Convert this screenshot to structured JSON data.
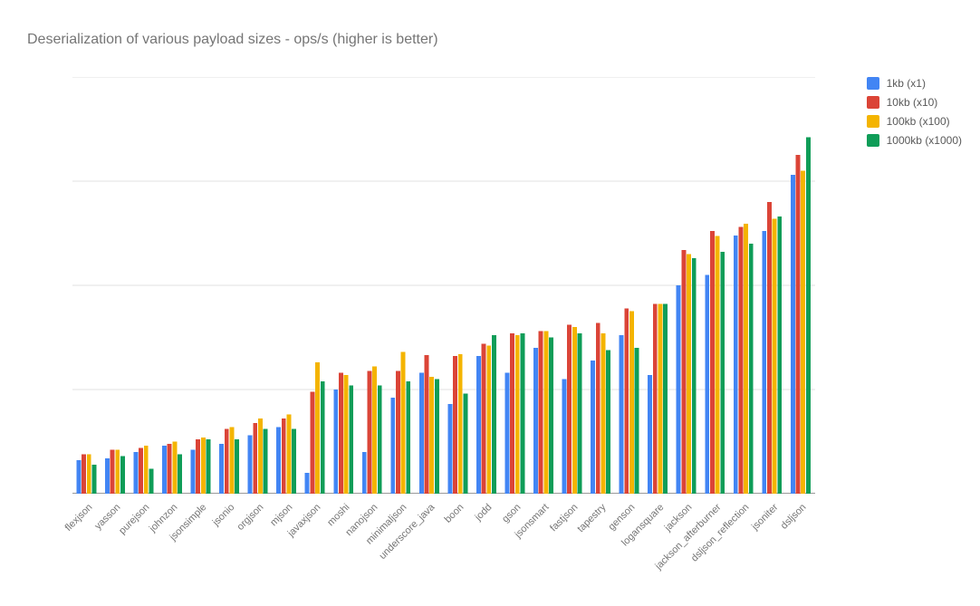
{
  "title": "Deserialization of various payload sizes  - ops/s (higher is better)",
  "legend": [
    {
      "label": "1kb (x1)",
      "color": "#4285f4"
    },
    {
      "label": "10kb (x10)",
      "color": "#db4437"
    },
    {
      "label": "100kb (x100)",
      "color": "#f4b400"
    },
    {
      "label": "1000kb (x1000)",
      "color": "#0f9d58"
    }
  ],
  "chart_data": {
    "type": "bar",
    "title": "Deserialization of various payload sizes  - ops/s (higher is better)",
    "xlabel": "",
    "ylabel": "",
    "ylim": [
      0,
      1000000
    ],
    "yticks": [
      0,
      250000,
      500000,
      750000,
      1000000
    ],
    "categories": [
      "flexjson",
      "yasson",
      "purejson",
      "johnzon",
      "jsonsimple",
      "jsonio",
      "orgjson",
      "mjson",
      "javaxjson",
      "moshi",
      "nanojson",
      "minimaljson",
      "underscore_java",
      "boon",
      "jodd",
      "gson",
      "jsonsmart",
      "fastjson",
      "tapestry",
      "genson",
      "logansquare",
      "jackson",
      "jackson_afterburner",
      "dsljson_reflection",
      "jsoniter",
      "dsljson"
    ],
    "series": [
      {
        "name": "1kb (x1)",
        "color": "#4285f4",
        "values": [
          80000,
          85000,
          100000,
          115000,
          105000,
          120000,
          140000,
          160000,
          50000,
          250000,
          100000,
          230000,
          290000,
          215000,
          330000,
          290000,
          350000,
          275000,
          320000,
          380000,
          285000,
          500000,
          525000,
          620000,
          630000,
          765000
        ]
      },
      {
        "name": "10kb (x10)",
        "color": "#db4437",
        "values": [
          95000,
          105000,
          110000,
          120000,
          130000,
          155000,
          170000,
          180000,
          245000,
          290000,
          295000,
          295000,
          333000,
          330000,
          360000,
          385000,
          390000,
          405000,
          410000,
          445000,
          455000,
          585000,
          630000,
          640000,
          700000,
          813000
        ]
      },
      {
        "name": "100kb (x100)",
        "color": "#f4b400",
        "values": [
          95000,
          105000,
          115000,
          125000,
          135000,
          160000,
          180000,
          190000,
          315000,
          285000,
          305000,
          340000,
          280000,
          335000,
          355000,
          380000,
          390000,
          400000,
          385000,
          438000,
          455000,
          575000,
          618000,
          648000,
          660000,
          775000
        ]
      },
      {
        "name": "1000kb (x1000)",
        "color": "#0f9d58",
        "values": [
          70000,
          90000,
          60000,
          95000,
          130000,
          130000,
          155000,
          155000,
          270000,
          260000,
          260000,
          270000,
          275000,
          240000,
          380000,
          385000,
          375000,
          385000,
          345000,
          350000,
          455000,
          565000,
          580000,
          600000,
          665000,
          855000
        ]
      }
    ]
  }
}
